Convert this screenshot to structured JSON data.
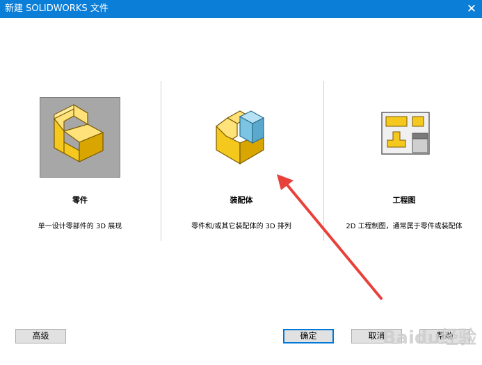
{
  "window": {
    "title": "新建 SOLIDWORKS 文件",
    "close_glyph": "✕"
  },
  "options": [
    {
      "label": "零件",
      "desc": "单一设计零部件的 3D 展现",
      "icon": "part-icon",
      "selected": true
    },
    {
      "label": "装配体",
      "desc": "零件和/或其它装配体的 3D 排列",
      "icon": "assembly-icon",
      "selected": false
    },
    {
      "label": "工程图",
      "desc": "2D 工程制图，通常属于零件或装配体",
      "icon": "drawing-icon",
      "selected": false
    }
  ],
  "buttons": {
    "advanced": "高级",
    "ok": "确定",
    "cancel": "取消",
    "help": "帮助"
  },
  "watermark": "Baidu经验",
  "colors": {
    "titlebar": "#0b7ed8",
    "part_yellow": "#f5c81e",
    "assembly_blue": "#7cc4e4",
    "arrow_red": "#e8403a"
  }
}
